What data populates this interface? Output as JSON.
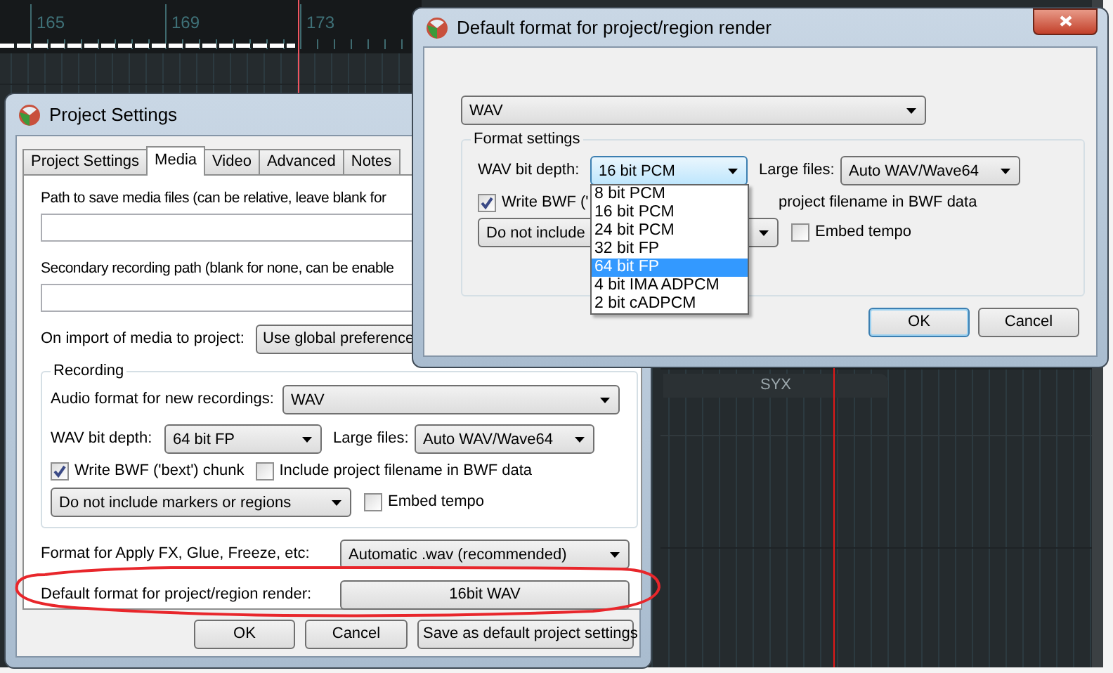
{
  "timeline": {
    "ruler_labels": [
      "165",
      "169",
      "173"
    ],
    "region_label": "SYX"
  },
  "project_settings": {
    "title": "Project Settings",
    "tabs": [
      {
        "label": "Project Settings",
        "selected": false
      },
      {
        "label": "Media",
        "selected": true
      },
      {
        "label": "Video",
        "selected": false
      },
      {
        "label": "Advanced",
        "selected": false
      },
      {
        "label": "Notes",
        "selected": false
      }
    ],
    "media_path": {
      "label": "Path to save media files (can be relative, leave blank for"
    },
    "secondary_path": {
      "label": "Secondary recording path (blank for none, can be enable"
    },
    "import": {
      "label": "On import of media to project:",
      "value": "Use global preference"
    },
    "recording": {
      "title": "Recording",
      "audio_format": {
        "label": "Audio format for new recordings:",
        "value": "WAV"
      },
      "bit_depth": {
        "label": "WAV bit depth:",
        "value": "64 bit FP"
      },
      "large_files": {
        "label": "Large files:",
        "value": "Auto WAV/Wave64"
      },
      "write_bwf": {
        "label": "Write BWF ('bext') chunk",
        "checked": true
      },
      "include_filename": {
        "label": "Include project filename in BWF data",
        "checked": false
      },
      "markers": {
        "value": "Do not include markers or regions"
      },
      "embed_tempo": {
        "label": "Embed tempo",
        "checked": false
      }
    },
    "apply_fx": {
      "label": "Format for Apply FX, Glue, Freeze, etc:",
      "value": "Automatic .wav (recommended)"
    },
    "render_format": {
      "label": "Default format for project/region render:",
      "value": "16bit WAV"
    },
    "buttons": [
      {
        "label": "OK",
        "default": false
      },
      {
        "label": "Cancel",
        "default": false
      },
      {
        "label": "Save as default project settings",
        "default": false
      }
    ]
  },
  "render_dialog": {
    "title": "Default format for project/region render",
    "format": "WAV",
    "group_title": "Format settings",
    "bit_depth": {
      "label": "WAV bit depth:",
      "value": "16 bit PCM"
    },
    "large_files": {
      "label": "Large files:",
      "value": "Auto WAV/Wave64"
    },
    "write_bwf": {
      "label": "Write BWF ('",
      "checked": true
    },
    "include_filename": {
      "label": "project filename in BWF data"
    },
    "markers": {
      "value": "Do not include"
    },
    "embed_tempo": {
      "label": "Embed tempo",
      "checked": false
    },
    "bit_depth_options": [
      {
        "label": "8 bit PCM",
        "selected": false
      },
      {
        "label": "16 bit PCM",
        "selected": false
      },
      {
        "label": "24 bit PCM",
        "selected": false
      },
      {
        "label": "32 bit FP",
        "selected": false
      },
      {
        "label": "64 bit FP",
        "selected": true
      },
      {
        "label": "4 bit IMA ADPCM",
        "selected": false
      },
      {
        "label": "2 bit cADPCM",
        "selected": false
      }
    ],
    "buttons": [
      {
        "label": "OK",
        "default": true
      },
      {
        "label": "Cancel",
        "default": false
      }
    ]
  }
}
